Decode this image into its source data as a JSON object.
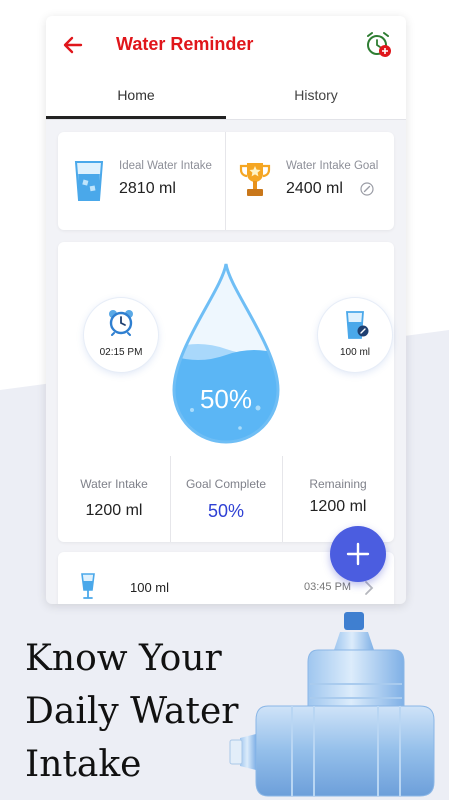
{
  "app": {
    "title": "Water Reminder"
  },
  "tabs": [
    {
      "label": "Home"
    },
    {
      "label": "History"
    }
  ],
  "goals": {
    "ideal_label": "Ideal Water Intake",
    "ideal_value": "2810 ml",
    "goal_label": "Water Intake Goal",
    "goal_value": "2400 ml"
  },
  "reminder": {
    "time": "02:15 PM"
  },
  "cup": {
    "size": "100 ml"
  },
  "progress": {
    "percent_text": "50%",
    "fill_fraction": 0.5
  },
  "stats": {
    "intake_label": "Water Intake",
    "intake_value": "1200 ml",
    "complete_label": "Goal Complete",
    "complete_value": "50%",
    "remaining_label": "Remaining",
    "remaining_value": "1200 ml"
  },
  "log": [
    {
      "amount": "100 ml",
      "time": "03:45 PM"
    }
  ],
  "headline": {
    "line1": "Know Your",
    "line2": "Daily Water",
    "line3": "Intake"
  },
  "colors": {
    "accent_red": "#e0161b",
    "primary_blue": "#4b5de0",
    "water_blue": "#5bb6f5",
    "goal_text": "#2f41d4"
  },
  "icons": [
    "back-arrow-icon",
    "alarm-add-icon",
    "water-glass-icon",
    "trophy-icon",
    "edit-icon",
    "alarm-clock-icon",
    "cup-icon",
    "water-drop-icon",
    "plus-icon",
    "chevron-right-icon",
    "water-bottle-icon"
  ]
}
